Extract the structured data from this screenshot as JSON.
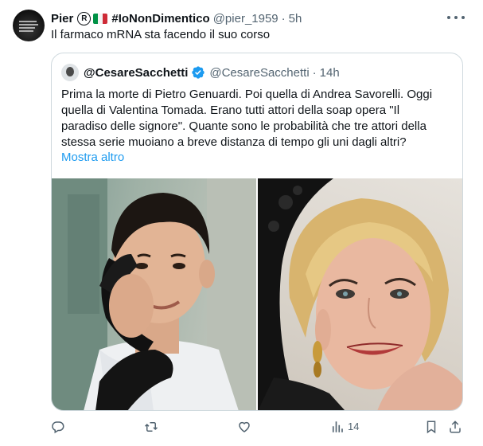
{
  "tweet": {
    "display_name": "Pier",
    "registered_symbol": "R",
    "hashtag_name": "#IoNonDimentico",
    "handle": "@pier_1959",
    "separator": "·",
    "time": "5h",
    "text": "Il farmaco mRNA sta facendo il suo corso",
    "more_icon": "more-horizontal-icon",
    "flag_colors": [
      "#009246",
      "#ffffff",
      "#ce2b37"
    ]
  },
  "quote": {
    "display_name": "@CesareSacchetti",
    "handle": "@CesareSacchetti",
    "separator": "·",
    "time": "14h",
    "verified_icon": "verified-badge-icon",
    "verified_color": "#1d9bf0",
    "lines": [
      "Prima la morte di Pietro Genuardi. Poi quella di Andrea Savorelli. Oggi",
      "quella di Valentina Tomada. Erano tutti attori della soap opera \"Il",
      "paradiso delle signore\". Quante sono le probabilità che tre attori della",
      "stessa serie muoiano a breve distanza di tempo gli uni dagli altri?"
    ],
    "show_more": "Mostra altro",
    "photos": [
      {
        "description_icon": "photo-young-man-telephone"
      },
      {
        "description_icon": "photo-blonde-woman-earrings"
      }
    ]
  },
  "actions": {
    "reply_icon": "reply-icon",
    "retweet_icon": "retweet-icon",
    "like_icon": "like-icon",
    "views_icon": "views-chart-icon",
    "views_count": "14",
    "bookmark_icon": "bookmark-icon",
    "share_icon": "share-icon"
  },
  "colors": {
    "text": "#0f1419",
    "secondary": "#536471",
    "link": "#1d9bf0",
    "border": "#cfd9de"
  }
}
